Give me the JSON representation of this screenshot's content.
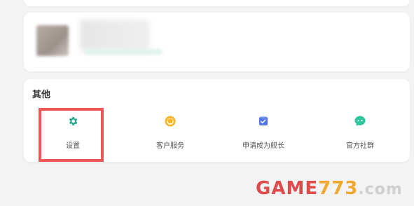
{
  "other_section": {
    "title": "其他",
    "items": [
      {
        "label": "设置",
        "icon": "gear-icon",
        "color": "#2aa88f"
      },
      {
        "label": "客户服务",
        "icon": "headset-icon",
        "color": "#f2a31b"
      },
      {
        "label": "申请成为舰长",
        "icon": "clipboard-check-icon",
        "color": "#5277e8"
      },
      {
        "label": "官方社群",
        "icon": "chat-bubble-icon",
        "color": "#2fc59e"
      }
    ]
  },
  "highlight": {
    "color": "#ef5757",
    "target": "设置"
  },
  "watermark": {
    "part1": "GAME",
    "part2": "773",
    "part3": ".com"
  }
}
